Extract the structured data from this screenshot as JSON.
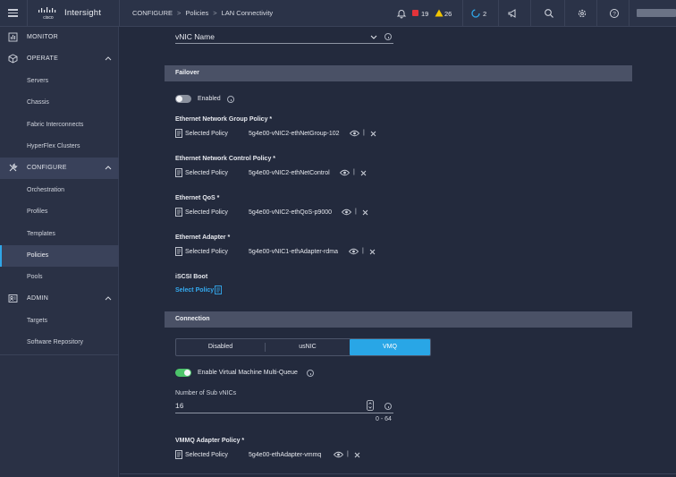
{
  "app": {
    "brand": "Intersight"
  },
  "breadcrumb": {
    "section": "CONFIGURE",
    "page": "Policies",
    "current": "LAN Connectivity",
    "separator": ">"
  },
  "topbar": {
    "alerts_critical": "19",
    "alerts_warning": "26",
    "tasks": "2",
    "colors": {
      "critical": "#e2333a",
      "warning": "#f2c500",
      "accent": "#2fa6e8"
    }
  },
  "sidebar": {
    "groups": [
      {
        "label": "MONITOR",
        "icon": "monitor-icon",
        "items": []
      },
      {
        "label": "OPERATE",
        "icon": "operate-icon",
        "items": [
          "Servers",
          "Chassis",
          "Fabric Interconnects",
          "HyperFlex Clusters"
        ]
      },
      {
        "label": "CONFIGURE",
        "icon": "configure-icon",
        "active": true,
        "items": [
          "Orchestration",
          "Profiles",
          "Templates",
          "Policies",
          "Pools"
        ]
      },
      {
        "label": "ADMIN",
        "icon": "admin-icon",
        "items": [
          "Targets",
          "Software Repository"
        ]
      }
    ],
    "active_item": "Policies"
  },
  "form": {
    "vnic_name_label": "vNIC Name",
    "failover": {
      "title": "Failover",
      "enabled_label": "Enabled",
      "enabled": false
    },
    "policies": [
      {
        "label": "Ethernet Network Group Policy *",
        "selected_label": "Selected Policy",
        "value": "5g4e00-vNIC2-ethNetGroup-102"
      },
      {
        "label": "Ethernet Network Control Policy *",
        "selected_label": "Selected Policy",
        "value": "5g4e00-vNIC2-ethNetControl"
      },
      {
        "label": "Ethernet QoS *",
        "selected_label": "Selected Policy",
        "value": "5g4e00-vNIC2-ethQoS-p9000"
      },
      {
        "label": "Ethernet Adapter *",
        "selected_label": "Selected Policy",
        "value": "5g4e00-vNIC1-ethAdapter-rdma"
      }
    ],
    "iscsi": {
      "label": "iSCSI Boot",
      "select_label": "Select Policy"
    },
    "connection": {
      "title": "Connection",
      "options": [
        "Disabled",
        "usNIC",
        "VMQ"
      ],
      "selected": "VMQ",
      "vmmq_label": "Enable Virtual Machine Multi-Queue",
      "vmmq_enabled": true,
      "sub_vnics_label": "Number of Sub vNICs",
      "sub_vnics_value": "16",
      "sub_vnics_range": "0 - 64",
      "vmmq_policy": {
        "label": "VMMQ Adapter Policy *",
        "selected_label": "Selected Policy",
        "value": "5g4e00-ethAdapter-vmmq"
      }
    }
  }
}
